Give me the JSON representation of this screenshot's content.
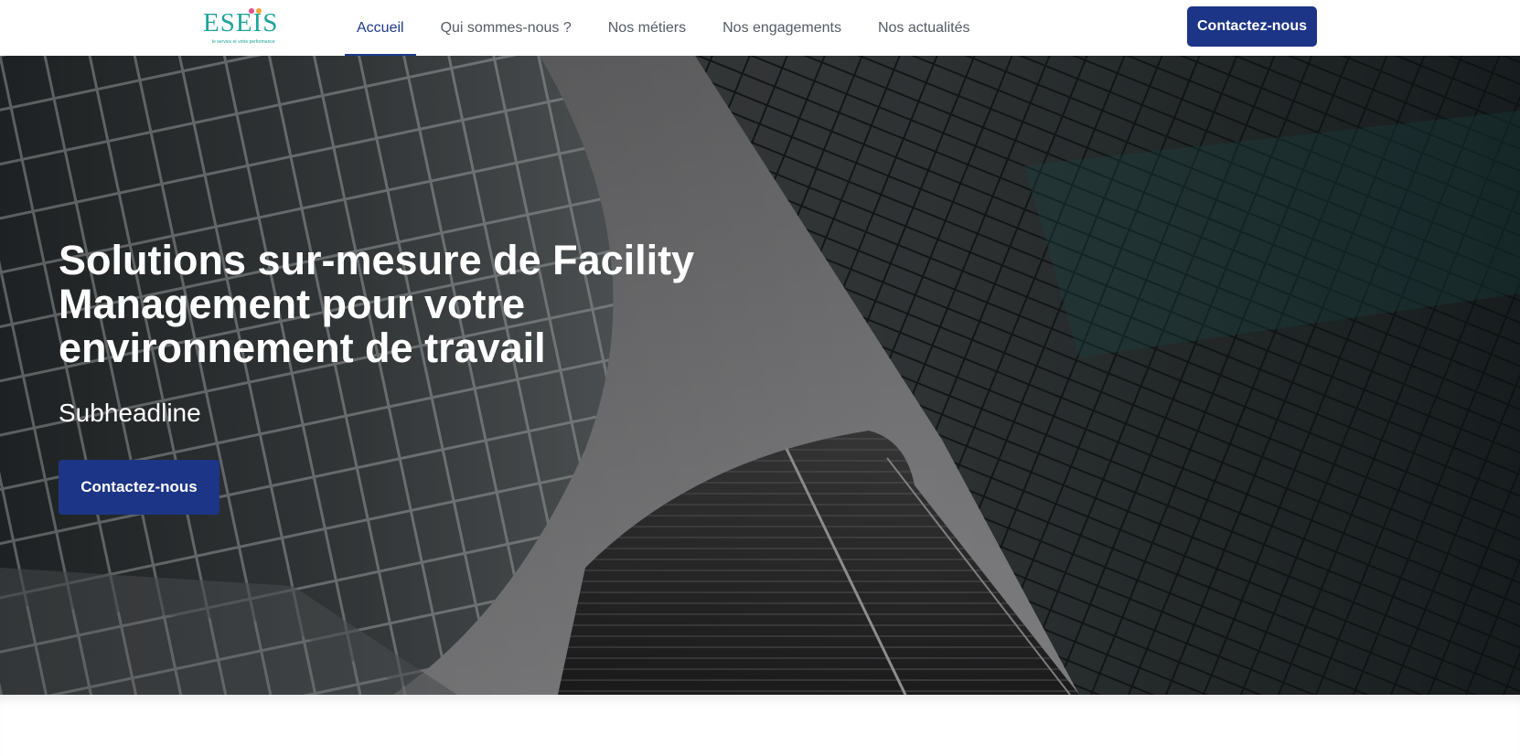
{
  "brand": {
    "name": "ESEIS",
    "tagline": "le service et votre performance",
    "color": "#1fa49b",
    "dot_colors": [
      "#e8508a",
      "#f2a63a"
    ]
  },
  "nav": {
    "items": [
      {
        "label": "Accueil",
        "active": true
      },
      {
        "label": "Qui sommes-nous ?",
        "active": false
      },
      {
        "label": "Nos métiers",
        "active": false
      },
      {
        "label": "Nos engagements",
        "active": false
      },
      {
        "label": "Nos actualités",
        "active": false
      }
    ],
    "active_color": "#1d3a8a",
    "contact_label": "Contactez-nous"
  },
  "hero": {
    "title": "Solutions sur-mesure de Facility Management pour votre environnement de travail",
    "subtitle": "Subheadline",
    "cta_label": "Contactez-nous",
    "button_color": "#1d3586",
    "background": "grayscale-glass-skyscrapers-photo"
  }
}
